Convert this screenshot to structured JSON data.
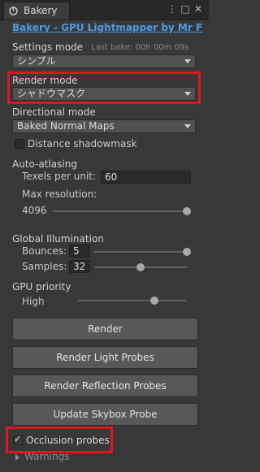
{
  "window": {
    "tab_label": "Bakery",
    "menu_glyph": "⋮",
    "maximize_glyph": "□",
    "close_glyph": "✕"
  },
  "header": {
    "title_link": "Bakery - GPU Lightmapper by Mr F"
  },
  "settings_mode": {
    "label": "Settings mode",
    "last_bake": "Last bake: 00h 00m 09s",
    "value": "シンプル"
  },
  "render_mode": {
    "label": "Render mode",
    "value": "シャドウマスク"
  },
  "directional_mode": {
    "label": "Directional mode",
    "value": "Baked Normal Maps"
  },
  "distance_shadowmask": {
    "label": "Distance shadowmask",
    "checked": false
  },
  "auto_atlasing": {
    "label": "Auto-atlasing",
    "texels_label": "Texels per unit:",
    "texels_value": "60",
    "max_res_label": "Max resolution:",
    "max_res_value": "4096",
    "max_res_fraction": 1.0
  },
  "global_illumination": {
    "label": "Global Illumination",
    "bounces_label": "Bounces:",
    "bounces_value": "5",
    "bounces_fraction": 1.0,
    "samples_label": "Samples:",
    "samples_value": "32",
    "samples_fraction": 0.5
  },
  "gpu_priority": {
    "label": "GPU priority",
    "value": "High",
    "fraction": 0.7
  },
  "buttons": {
    "render": "Render",
    "render_light_probes": "Render Light Probes",
    "render_reflection_probes": "Render Reflection Probes",
    "update_skybox_probe": "Update Skybox Probe"
  },
  "occlusion_probes": {
    "label": "Occlusion probes",
    "checked": true,
    "check_glyph": "✓"
  },
  "warnings": {
    "label": "Warnings"
  },
  "colors": {
    "highlight": "#e0161f",
    "link": "#4d9be8",
    "background": "#383838"
  }
}
